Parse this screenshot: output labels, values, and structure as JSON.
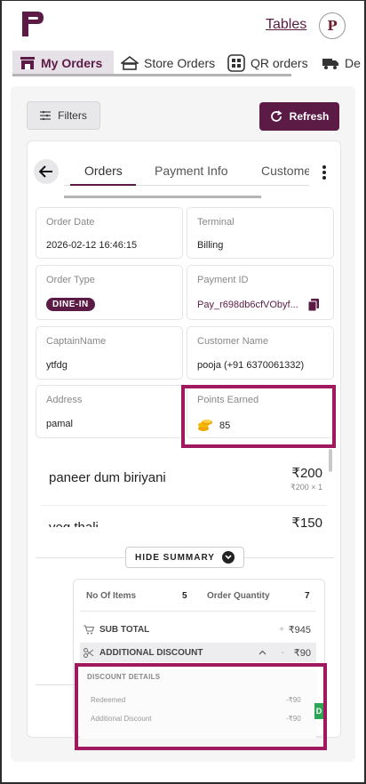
{
  "header": {
    "tables_link": "Tables",
    "avatar_letter": "P"
  },
  "top_tabs": [
    {
      "label": "My Orders",
      "icon": "store-icon",
      "active": true
    },
    {
      "label": "Store Orders",
      "icon": "stores-icon",
      "active": false
    },
    {
      "label": "QR orders",
      "icon": "qr-icon",
      "active": false
    },
    {
      "label": "De",
      "icon": "delivery-icon",
      "active": false
    }
  ],
  "toolbar": {
    "filters_label": "Filters",
    "refresh_label": "Refresh"
  },
  "card_tabs": [
    {
      "label": "Orders",
      "active": true
    },
    {
      "label": "Payment Info",
      "active": false
    },
    {
      "label": "Custome",
      "active": false
    }
  ],
  "order_info": {
    "order_date_label": "Order Date",
    "order_date": "2026-02-12 16:46:15",
    "terminal_label": "Terminal",
    "terminal": "Billing",
    "order_type_label": "Order Type",
    "order_type": "DINE-IN",
    "payment_id_label": "Payment ID",
    "payment_id": "Pay_r698db6cfVObyf...",
    "captain_label": "CaptainName",
    "captain": "ytfdg",
    "customer_label": "Customer Name",
    "customer": "pooja (+91 6370061332)",
    "address_label": "Address",
    "address": "pamal",
    "points_label": "Points Earned",
    "points": "85"
  },
  "items": [
    {
      "name": "paneer dum biriyani",
      "price": "₹200",
      "sub": "₹200 × 1"
    },
    {
      "name": "veg thali",
      "price": "₹150",
      "sub": ""
    }
  ],
  "summary": {
    "hide_label": "HIDE SUMMARY",
    "no_of_items_label": "No Of Items",
    "no_of_items": "5",
    "order_quantity_label": "Order Quantity",
    "order_quantity": "7",
    "sub_total_label": "SUB TOTAL",
    "sub_total_op": "+",
    "sub_total": "₹945",
    "discount_label": "ADDITIONAL DISCOUNT",
    "discount_op": "-",
    "discount": "₹90",
    "discount_details_title": "DISCOUNT DETAILS",
    "redeemed_label": "Redeemed",
    "redeemed": "-₹90",
    "additional_discount_label": "Additional Discount",
    "additional_discount": "-₹90",
    "green_tag": "D"
  },
  "colors": {
    "brand": "#5b1b45",
    "highlight": "#a0195f",
    "coins": "#f0a500"
  }
}
